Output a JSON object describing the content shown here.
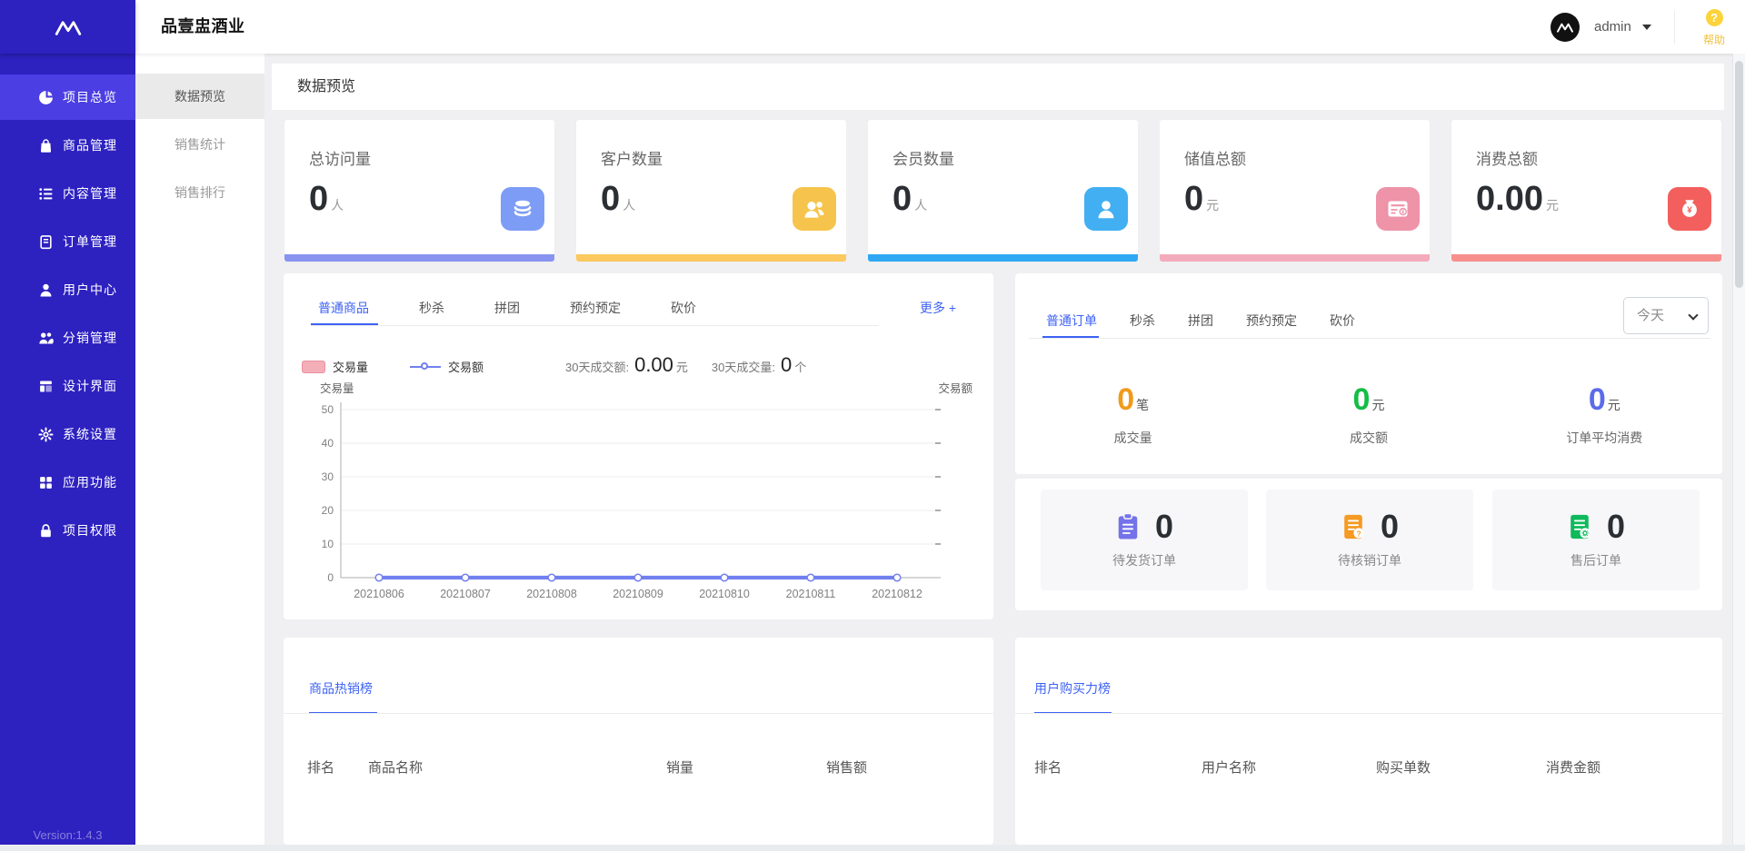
{
  "brand": {
    "title": "品壹盅酒业"
  },
  "header": {
    "username": "admin",
    "help_label": "帮助",
    "help_glyph": "?"
  },
  "sidebar": {
    "items": [
      {
        "label": "项目总览",
        "icon": "pie-chart",
        "active": true
      },
      {
        "label": "商品管理",
        "icon": "shopping-bag",
        "active": false
      },
      {
        "label": "内容管理",
        "icon": "list",
        "active": false
      },
      {
        "label": "订单管理",
        "icon": "order-doc",
        "active": false
      },
      {
        "label": "用户中心",
        "icon": "user",
        "active": false
      },
      {
        "label": "分销管理",
        "icon": "users",
        "active": false
      },
      {
        "label": "设计界面",
        "icon": "layout",
        "active": false
      },
      {
        "label": "系统设置",
        "icon": "gear",
        "active": false
      },
      {
        "label": "应用功能",
        "icon": "app-grid",
        "active": false
      },
      {
        "label": "项目权限",
        "icon": "lock",
        "active": false
      }
    ],
    "version": "Version:1.4.3"
  },
  "submenu": {
    "items": [
      {
        "label": "数据预览",
        "active": true
      },
      {
        "label": "销售统计",
        "active": false
      },
      {
        "label": "销售排行",
        "active": false
      }
    ]
  },
  "page": {
    "title": "数据预览"
  },
  "stat_cards": [
    {
      "title": "总访问量",
      "value": "0",
      "unit": "人",
      "icon": "database",
      "icon_color": "#7d9cf6",
      "bar_color": "#8894f0"
    },
    {
      "title": "客户数量",
      "value": "0",
      "unit": "人",
      "icon": "customers",
      "icon_color": "#f6c44c",
      "bar_color": "#fbc95d"
    },
    {
      "title": "会员数量",
      "value": "0",
      "unit": "人",
      "icon": "member",
      "icon_color": "#41aff2",
      "bar_color": "#2fa8f4"
    },
    {
      "title": "储值总额",
      "value": "0",
      "unit": "元",
      "icon": "stored-value-card",
      "icon_color": "#ee93a8",
      "bar_color": "#f3abbc"
    },
    {
      "title": "消费总额",
      "value": "0.00",
      "unit": "元",
      "icon": "money-bag",
      "icon_color": "#f25f5c",
      "bar_color": "#f78f8c"
    }
  ],
  "trade_panel": {
    "tabs": [
      "普通商品",
      "秒杀",
      "拼团",
      "预约预定",
      "砍价"
    ],
    "more": "更多 +",
    "legend": [
      "交易量",
      "交易额"
    ],
    "summary": [
      {
        "label": "30天成交额:",
        "value": "0.00",
        "unit": "元"
      },
      {
        "label": "30天成交量:",
        "value": "0",
        "unit": "个"
      }
    ]
  },
  "chart_data": {
    "type": "line",
    "categories": [
      "20210806",
      "20210807",
      "20210808",
      "20210809",
      "20210810",
      "20210811",
      "20210812"
    ],
    "series": [
      {
        "name": "交易量",
        "type": "bar",
        "values": [
          0,
          0,
          0,
          0,
          0,
          0,
          0
        ]
      },
      {
        "name": "交易额",
        "type": "line",
        "values": [
          0,
          0,
          0,
          0,
          0,
          0,
          0
        ]
      }
    ],
    "title": "",
    "xlabel": "",
    "ylabel_left": "交易量",
    "ylabel_right": "交易额",
    "ylim": [
      0,
      50
    ],
    "yticks": [
      0,
      10,
      20,
      30,
      40,
      50
    ],
    "grid": true,
    "line_color": "#7280ef",
    "legend_position": "top-left"
  },
  "order_panel": {
    "tabs": [
      "普通订单",
      "秒杀",
      "拼团",
      "预约预定",
      "砍价"
    ],
    "range": "今天",
    "stats": [
      {
        "value": "0",
        "unit": "笔",
        "label": "成交量",
        "color": "#f09b1c"
      },
      {
        "value": "0",
        "unit": "元",
        "label": "成交额",
        "color": "#15bd47"
      },
      {
        "value": "0",
        "unit": "元",
        "label": "订单平均消费",
        "color": "#5a6cea"
      }
    ]
  },
  "order_status": [
    {
      "value": "0",
      "label": "待发货订单",
      "icon": "clipboard",
      "color": "#7472e9"
    },
    {
      "value": "0",
      "label": "待核销订单",
      "icon": "doc-question",
      "color": "#f59a23"
    },
    {
      "value": "0",
      "label": "售后订单",
      "icon": "doc-gear",
      "color": "#0fb95c"
    }
  ],
  "hot_goods": {
    "tab": "商品热销榜",
    "columns": [
      "排名",
      "商品名称",
      "销量",
      "销售额"
    ],
    "rows": []
  },
  "buyer_rank": {
    "tab": "用户购买力榜",
    "columns": [
      "排名",
      "用户名称",
      "购买单数",
      "消费金额"
    ],
    "rows": []
  }
}
